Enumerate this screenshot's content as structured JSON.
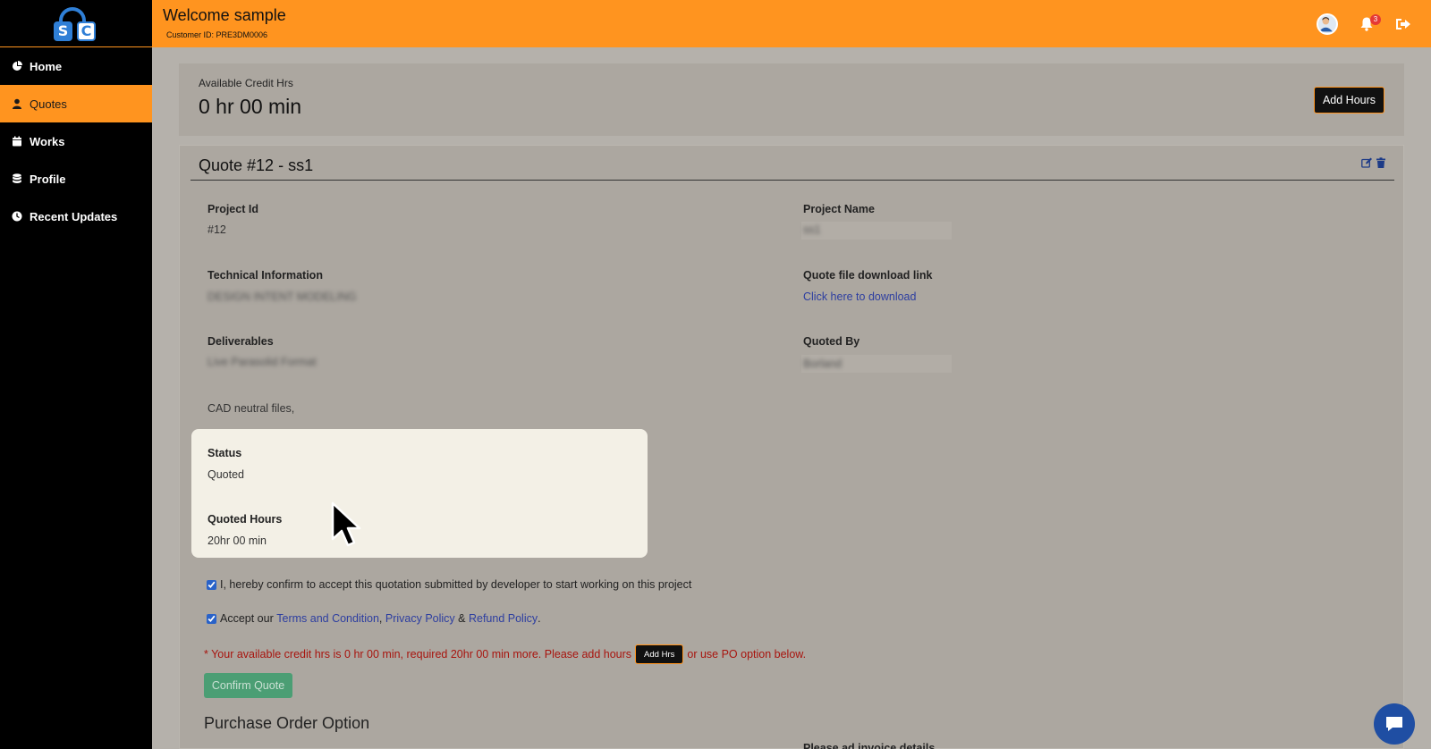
{
  "sidebar": {
    "logo_letters": [
      "S",
      "C"
    ],
    "items": [
      {
        "label": "Home",
        "icon": "pie-chart-icon",
        "active": false
      },
      {
        "label": "Quotes",
        "icon": "user-icon",
        "active": true
      },
      {
        "label": "Works",
        "icon": "calendar-icon",
        "active": false
      },
      {
        "label": "Profile",
        "icon": "database-icon",
        "active": false
      },
      {
        "label": "Recent Updates",
        "icon": "clock-icon",
        "active": false
      }
    ]
  },
  "header": {
    "welcome": "Welcome sample",
    "customer_id": "Customer ID: PRE3DM0006",
    "notification_count": "3",
    "accent_color": "#ff941f"
  },
  "credit": {
    "label": "Available Credit Hrs",
    "value": "0 hr 00 min",
    "add_hours_label": "Add Hours"
  },
  "quote": {
    "title": "Quote #12 - ss1",
    "fields": {
      "project_id_label": "Project Id",
      "project_id_value": "#12",
      "project_name_label": "Project Name",
      "project_name_value": "ss1",
      "technical_info_label": "Technical Information",
      "technical_info_value": "DESIGN INTENT MODELING",
      "download_label": "Quote file download link",
      "download_link": "Click here to download",
      "deliverables_label": "Deliverables",
      "deliverables_value": "Live Parasolid Format",
      "quoted_by_label": "Quoted By",
      "quoted_by_value": "Borland",
      "deliverables_extra": "CAD neutral files,",
      "status_label": "Status",
      "status_value": "Quoted",
      "quoted_hours_label": "Quoted Hours",
      "quoted_hours_value": "20hr 00 min"
    },
    "confirm_text": "I, hereby confirm to accept this quotation submitted by developer to start working on this project",
    "accept_prefix": "Accept our",
    "terms_link": "Terms and Condition",
    "comma": ",",
    "privacy_link": "Privacy Policy",
    "ampersand": "&",
    "refund_link": "Refund Policy",
    "period": ".",
    "warning_prefix": "* Your available credit hrs is 0 hr 00 min, required 20hr 00 min more. Please add hours",
    "add_hrs_label": "Add Hrs",
    "warning_suffix": "or use PO option below.",
    "confirm_button": "Confirm Quote",
    "po_heading": "Purchase Order Option",
    "po_cutoff_label": "Please ad invoice details"
  }
}
